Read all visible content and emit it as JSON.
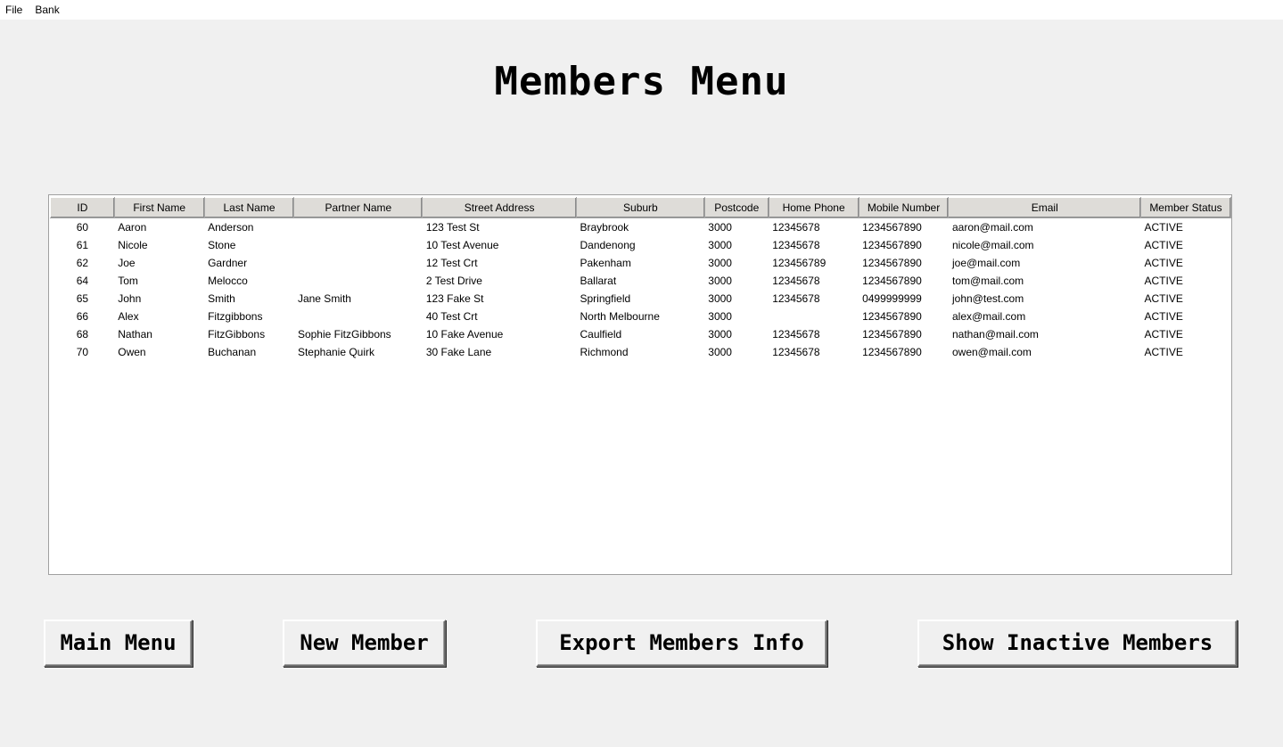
{
  "menubar": {
    "items": [
      "File",
      "Bank"
    ]
  },
  "title": "Members Menu",
  "table": {
    "columns": [
      "ID",
      "First Name",
      "Last Name",
      "Partner Name",
      "Street Address",
      "Suburb",
      "Postcode",
      "Home Phone",
      "Mobile Number",
      "Email",
      "Member Status"
    ],
    "rows": [
      [
        "60",
        "Aaron",
        "Anderson",
        "",
        "123 Test St",
        "Braybrook",
        "3000",
        "12345678",
        "1234567890",
        "aaron@mail.com",
        "ACTIVE"
      ],
      [
        "61",
        "Nicole",
        "Stone",
        "",
        "10 Test Avenue",
        "Dandenong",
        "3000",
        "12345678",
        "1234567890",
        "nicole@mail.com",
        "ACTIVE"
      ],
      [
        "62",
        "Joe",
        "Gardner",
        "",
        "12 Test Crt",
        "Pakenham",
        "3000",
        "123456789",
        "1234567890",
        "joe@mail.com",
        "ACTIVE"
      ],
      [
        "64",
        "Tom",
        "Melocco",
        "",
        "2 Test Drive",
        "Ballarat",
        "3000",
        "12345678",
        "1234567890",
        "tom@mail.com",
        "ACTIVE"
      ],
      [
        "65",
        "John",
        "Smith",
        "Jane Smith",
        "123 Fake St",
        "Springfield",
        "3000",
        "12345678",
        "0499999999",
        "john@test.com",
        "ACTIVE"
      ],
      [
        "66",
        "Alex",
        "Fitzgibbons",
        "",
        "40 Test Crt",
        "North Melbourne",
        "3000",
        "",
        "1234567890",
        "alex@mail.com",
        "ACTIVE"
      ],
      [
        "68",
        "Nathan",
        "FitzGibbons",
        "Sophie FitzGibbons",
        "10 Fake Avenue",
        "Caulfield",
        "3000",
        "12345678",
        "1234567890",
        "nathan@mail.com",
        "ACTIVE"
      ],
      [
        "70",
        "Owen",
        "Buchanan",
        "Stephanie Quirk",
        "30 Fake Lane",
        "Richmond",
        "3000",
        "12345678",
        "1234567890",
        "owen@mail.com",
        "ACTIVE"
      ]
    ]
  },
  "buttons": {
    "main_menu": "Main Menu",
    "new_member": "New Member",
    "export": "Export Members Info",
    "show_inactive": "Show Inactive Members"
  }
}
